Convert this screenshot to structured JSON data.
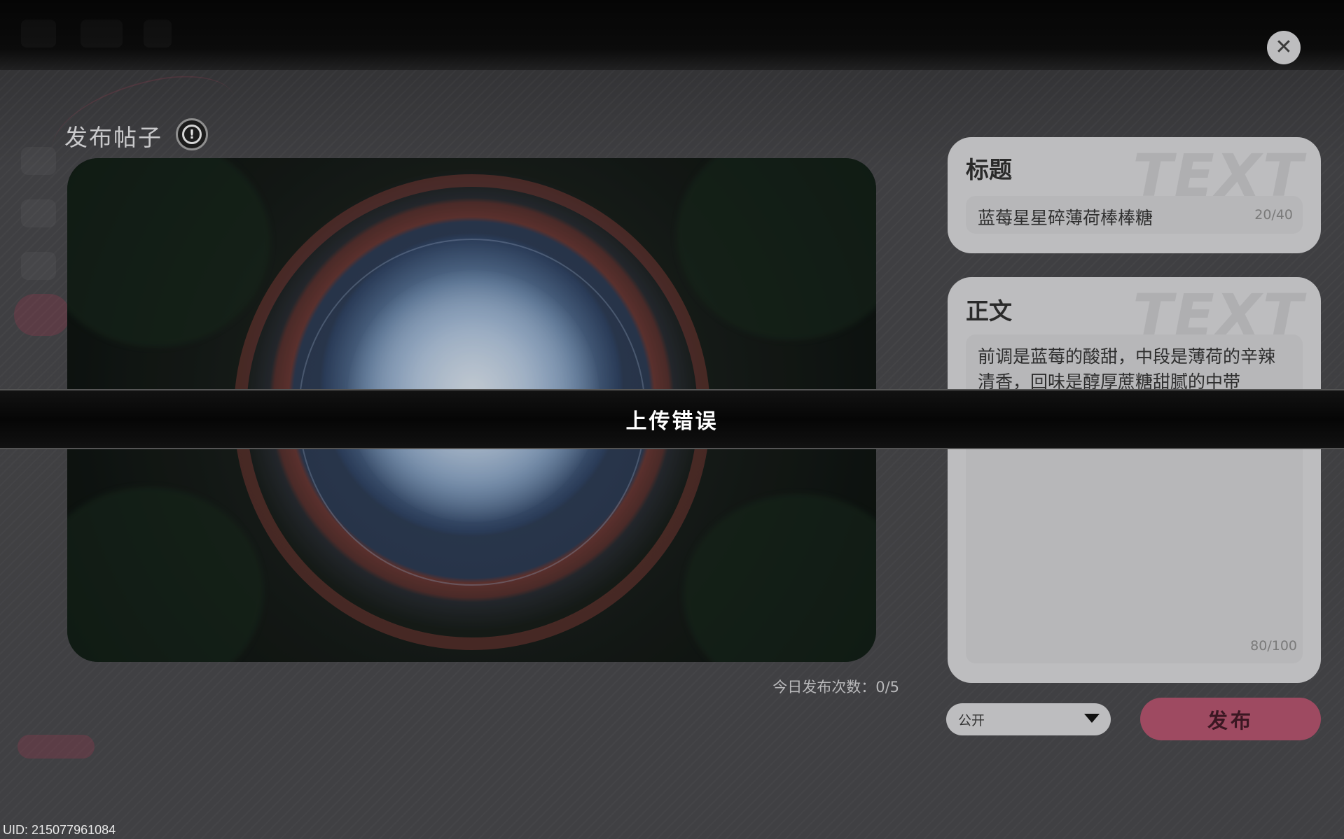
{
  "window": {
    "close_icon": "close-icon"
  },
  "composer": {
    "title": "发布帖子",
    "info_icon": "exclamation-circle-icon",
    "daily_count": "今日发布次数：0/5"
  },
  "title_card": {
    "label": "标题",
    "value": "蓝莓星星碎薄荷棒棒糖",
    "count": "20/40"
  },
  "body_card": {
    "label": "正文",
    "value": "前调是蓝莓的酸甜，中段是薄荷的辛辣清香，回味是醇厚蔗糖甜腻的中带",
    "count": "80/100"
  },
  "visibility": {
    "selected": "公开",
    "chevron_icon": "chevron-down-icon"
  },
  "publish_button": {
    "label": "发布"
  },
  "toast": {
    "message": "上传错误"
  },
  "uid": "UID: 215077961084",
  "colors": {
    "accent": "#9e4a61",
    "card": "#bdbdbf"
  }
}
